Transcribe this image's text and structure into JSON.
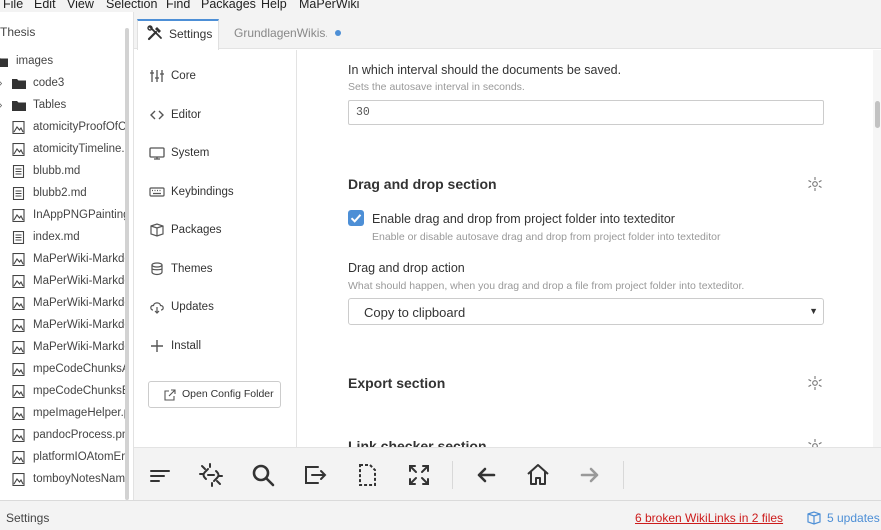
{
  "menu": [
    "File",
    "Edit",
    "View",
    "Selection",
    "Find",
    "Packages",
    "Help",
    "MaPerWiki"
  ],
  "tree": {
    "root": "Thesis",
    "items": [
      {
        "label": "images",
        "kind": "folder",
        "icon": "folder-icon",
        "expanded": true
      },
      {
        "label": "code3",
        "kind": "folder",
        "icon": "folder-icon",
        "expanded": false
      },
      {
        "label": "Tables",
        "kind": "folder",
        "icon": "folder-icon",
        "expanded": false
      },
      {
        "label": "atomicityProofOfC",
        "kind": "file",
        "icon": "image-file-icon"
      },
      {
        "label": "atomicityTimeline.",
        "kind": "file",
        "icon": "image-file-icon"
      },
      {
        "label": "blubb.md",
        "kind": "file",
        "icon": "text-file-icon"
      },
      {
        "label": "blubb2.md",
        "kind": "file",
        "icon": "text-file-icon"
      },
      {
        "label": "InAppPNGPainting",
        "kind": "file",
        "icon": "image-file-icon"
      },
      {
        "label": "index.md",
        "kind": "file",
        "icon": "text-file-icon"
      },
      {
        "label": "MaPerWiki-Markdo",
        "kind": "file",
        "icon": "image-file-icon"
      },
      {
        "label": "MaPerWiki-Markdo",
        "kind": "file",
        "icon": "image-file-icon"
      },
      {
        "label": "MaPerWiki-Markdo",
        "kind": "file",
        "icon": "image-file-icon"
      },
      {
        "label": "MaPerWiki-Markdo",
        "kind": "file",
        "icon": "image-file-icon"
      },
      {
        "label": "MaPerWiki-Markdo",
        "kind": "file",
        "icon": "image-file-icon"
      },
      {
        "label": "mpeCodeChunksA",
        "kind": "file",
        "icon": "image-file-icon"
      },
      {
        "label": "mpeCodeChunksB",
        "kind": "file",
        "icon": "image-file-icon"
      },
      {
        "label": "mpeImageHelper.p",
        "kind": "file",
        "icon": "image-file-icon"
      },
      {
        "label": "pandocProcess.pn",
        "kind": "file",
        "icon": "image-file-icon"
      },
      {
        "label": "platformIOAtomEr",
        "kind": "file",
        "icon": "image-file-icon"
      },
      {
        "label": "tomboyNotesNam",
        "kind": "file",
        "icon": "image-file-icon"
      }
    ]
  },
  "tabs": [
    {
      "label": "Settings",
      "icon": "tools-icon",
      "active": true
    },
    {
      "label": "GrundlagenWikis.m",
      "active": false,
      "modified": true
    }
  ],
  "settings_nav": {
    "items": [
      {
        "label": "Core",
        "icon": "sliders-icon"
      },
      {
        "label": "Editor",
        "icon": "code-icon"
      },
      {
        "label": "System",
        "icon": "monitor-icon"
      },
      {
        "label": "Keybindings",
        "icon": "keyboard-icon"
      },
      {
        "label": "Packages",
        "icon": "package-icon"
      },
      {
        "label": "Themes",
        "icon": "paintcan-icon"
      },
      {
        "label": "Updates",
        "icon": "cloud-download-icon"
      },
      {
        "label": "Install",
        "icon": "plus-icon"
      }
    ],
    "open_config_label": "Open Config Folder"
  },
  "content": {
    "autosave": {
      "title": "In which interval should the documents be saved.",
      "description": "Sets the autosave interval in seconds.",
      "value": "30"
    },
    "dnd_section": {
      "title": "Drag and drop section",
      "checkbox_label": "Enable drag and drop from project folder into texteditor",
      "checkbox_checked": true,
      "checkbox_description": "Enable or disable autosave drag and drop from project folder into texteditor",
      "action_title": "Drag and drop action",
      "action_description": "What should happen, when you drag and drop a file from project folder into texteditor.",
      "action_value": "Copy to clipboard"
    },
    "export_section": {
      "title": "Export section"
    },
    "link_checker_section": {
      "title": "Link checker section"
    }
  },
  "toolbar": [
    "sort-lines-icon",
    "unlink-icon",
    "search-icon",
    "export-icon",
    "new-file-icon",
    "fullscreen-icon",
    "back-arrow-icon",
    "home-icon",
    "forward-arrow-icon"
  ],
  "status": {
    "left": "Settings",
    "broken_links": "6 broken WikiLinks in 2 files",
    "updates": "5 updates"
  },
  "colors": {
    "accent": "#4d8fd6",
    "error": "#cc1b1b"
  }
}
